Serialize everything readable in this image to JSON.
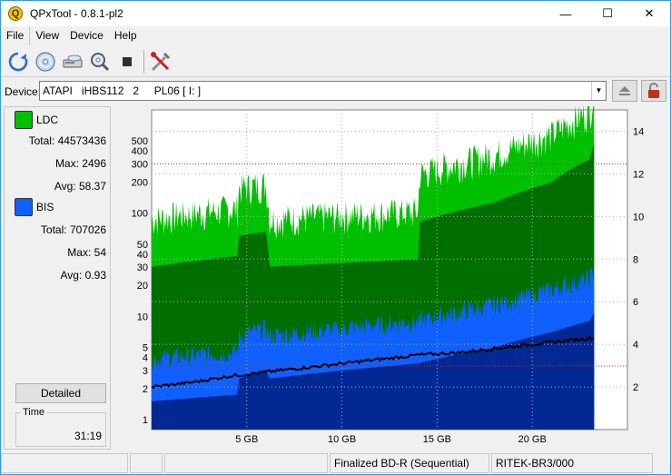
{
  "window": {
    "title": "QPxTool - 0.8.1-pl2",
    "app_icon_letter": "Q"
  },
  "window_controls": {
    "minimize": "—",
    "maximize": "☐",
    "close": "✕"
  },
  "menu": [
    "File",
    "View",
    "Device",
    "Help"
  ],
  "toolbar": {
    "buttons": [
      "refresh-icon",
      "disc-icon",
      "scanner-icon",
      "magnifier-disc-icon",
      "stop-icon",
      "tools-icon"
    ]
  },
  "device": {
    "label": "Device:",
    "selected": "ATAPI   iHBS112   2     PL06 [ I: ]",
    "buttons": [
      "eject-icon",
      "lock-icon"
    ]
  },
  "legend": {
    "ldc": {
      "name": "LDC",
      "color": "#00c000",
      "total_label": "Total:",
      "total": "44573436",
      "max_label": "Max:",
      "max": "2496",
      "avg_label": "Avg:",
      "avg": "58.37"
    },
    "bis": {
      "name": "BIS",
      "color": "#1060ff",
      "total_label": "Total:",
      "total": "707026",
      "max_label": "Max:",
      "max": "54",
      "avg_label": "Avg:",
      "avg": "0.93"
    }
  },
  "detailed_button": "Detailed",
  "time": {
    "label": "Time",
    "value": "31:19"
  },
  "status": {
    "cell1": "",
    "cell2": "",
    "disc_type": "Finalized BD-R (Sequential)",
    "media_id": "RITEK-BR3/000"
  },
  "chart_data": {
    "type": "area",
    "x_unit": "GB",
    "x_ticks": [
      "5 GB",
      "10 GB",
      "15 GB",
      "20 GB"
    ],
    "x_tick_values": [
      5,
      10,
      15,
      20
    ],
    "xlim": [
      0,
      25
    ],
    "data_end_gb": 23.3,
    "y_left_scale": "log",
    "y_left_ticks": [
      "1",
      "2",
      "3",
      "4",
      "5",
      "10",
      "20",
      "30",
      "40",
      "50",
      "100",
      "200",
      "300",
      "400",
      "500"
    ],
    "y_left_tick_values": [
      1,
      2,
      3,
      4,
      5,
      10,
      20,
      30,
      40,
      50,
      100,
      200,
      300,
      400,
      500
    ],
    "y_left_lim": [
      0.8,
      1000
    ],
    "y_right_ticks": [
      "2",
      "4",
      "6",
      "8",
      "10",
      "12",
      "14"
    ],
    "y_right_tick_values": [
      2,
      4,
      6,
      8,
      10,
      12,
      14
    ],
    "y_right_lim": [
      0,
      15
    ],
    "threshold_lines_left": [
      3.3,
      300
    ],
    "series": [
      {
        "name": "LDC",
        "color": "#00c000",
        "dark_color": "#006000",
        "x": [
          0,
          4.5,
          4.6,
          6,
          6.2,
          14,
          14.1,
          18,
          21,
          23,
          23.3
        ],
        "values": [
          55,
          70,
          110,
          120,
          55,
          65,
          150,
          230,
          360,
          600,
          900
        ]
      },
      {
        "name": "BIS",
        "color": "#1060ff",
        "dark_color": "#002080",
        "x": [
          0,
          4.5,
          4.6,
          6,
          6.2,
          14,
          18,
          21,
          23,
          23.3
        ],
        "values": [
          3,
          3.5,
          5,
          6,
          5,
          7,
          10,
          14,
          18,
          22
        ]
      },
      {
        "name": "Speed",
        "color": "#000000",
        "x": [
          0,
          2,
          4,
          6,
          8,
          10,
          12,
          14,
          16,
          18,
          20,
          22,
          23.3
        ],
        "values": [
          2.0,
          2.2,
          2.5,
          2.7,
          2.9,
          3.1,
          3.3,
          3.5,
          3.6,
          3.8,
          4.0,
          4.2,
          4.3
        ]
      }
    ]
  }
}
